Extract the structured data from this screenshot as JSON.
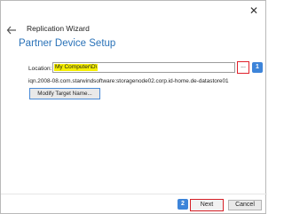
{
  "window": {
    "title": "Replication Wizard",
    "close_glyph": "✕"
  },
  "page": {
    "title": "Partner Device Setup"
  },
  "location": {
    "label": "Location:",
    "value": "My Computer\\D\\",
    "browse_label": "...",
    "highlight_color": "#f6ef00"
  },
  "target": {
    "iqn": "iqn.2008-08.com.starwindsoftware:storagenode02.corp.id-home.de-datastore01"
  },
  "buttons": {
    "modify_target_name": "Modify Target Name...",
    "next": "Next",
    "cancel": "Cancel"
  },
  "annotations": {
    "step_1": "1",
    "step_2": "2",
    "badge_color": "#3d84d9",
    "box_color": "#e0212b"
  },
  "icons": {
    "back": "back-arrow-icon",
    "close": "close-icon"
  }
}
